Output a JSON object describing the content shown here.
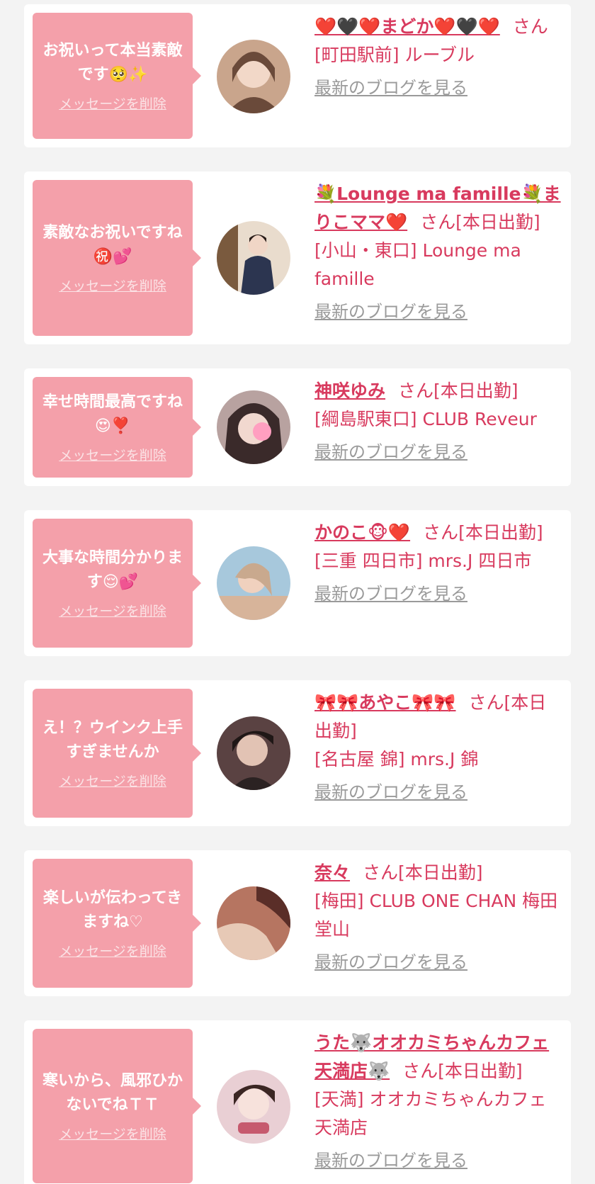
{
  "cards": [
    {
      "message": "お祝いって本当素敵です🥺✨",
      "delete_label": "メッセージを削除",
      "avatar": "photo-avatar",
      "name": "❤️🖤❤️まどか❤️🖤❤️",
      "san": "さん",
      "status": "",
      "shop": "[町田駅前] ルーブル",
      "blog_label": "最新のブログを見る",
      "avatar_colors": [
        "#c9a58c",
        "#6a4a3a"
      ]
    },
    {
      "message": "素敵なお祝いですね㊗️💕",
      "delete_label": "メッセージを削除",
      "avatar": "photo-avatar",
      "name": "💐Lounge ma famille💐まりこママ❤️",
      "san": "さん",
      "status": "[本日出勤]",
      "shop": "[小山・東口] Lounge ma famille",
      "blog_label": "最新のブログを見る",
      "avatar_colors": [
        "#e9dccd",
        "#2c3550"
      ]
    },
    {
      "message": "幸せ時間最高ですね😍❣️",
      "delete_label": "メッセージを削除",
      "avatar": "photo-avatar",
      "name": "神咲ゆみ",
      "san": "さん",
      "status": "[本日出勤]",
      "shop": "[綱島駅東口] CLUB Reveur",
      "blog_label": "最新のブログを見る",
      "avatar_colors": [
        "#b8a2a0",
        "#3a2a2a"
      ]
    },
    {
      "message": "大事な時間分かります😌💕",
      "delete_label": "メッセージを削除",
      "avatar": "photo-avatar",
      "name": "かのこ🐵❤️",
      "san": "さん",
      "status": "[本日出勤]",
      "shop": "[三重 四日市] mrs.J 四日市",
      "blog_label": "最新のブログを見る",
      "avatar_colors": [
        "#a7c8dc",
        "#d7b49a"
      ]
    },
    {
      "message": "え！？ウインク上手すぎませんか",
      "delete_label": "メッセージを削除",
      "avatar": "photo-avatar",
      "name": "🎀🎀あやこ🎀🎀",
      "san": "さん",
      "status": "[本日出勤]",
      "shop": "[名古屋 錦] mrs.J 錦",
      "blog_label": "最新のブログを見る",
      "avatar_colors": [
        "#5a4242",
        "#e2c3b4"
      ]
    },
    {
      "message": "楽しいが伝わってきますね♡",
      "delete_label": "メッセージを削除",
      "avatar": "photo-avatar",
      "name": "奈々",
      "san": "さん",
      "status": "[本日出勤]",
      "shop": "[梅田] CLUB ONE CHAN 梅田堂山",
      "blog_label": "最新のブログを見る",
      "avatar_colors": [
        "#b67561",
        "#e7c9b6"
      ]
    },
    {
      "message": "寒いから、風邪ひかないでねＴＴ",
      "delete_label": "メッセージを削除",
      "avatar": "photo-avatar",
      "name": "うた🐺オオカミちゃんカフェ天満店🐺",
      "san": "さん",
      "status": "[本日出勤]",
      "shop": "[天満] オオカミちゃんカフェ天満店",
      "blog_label": "最新のブログを見る",
      "avatar_colors": [
        "#e9cfd4",
        "#c65a6e"
      ]
    }
  ]
}
